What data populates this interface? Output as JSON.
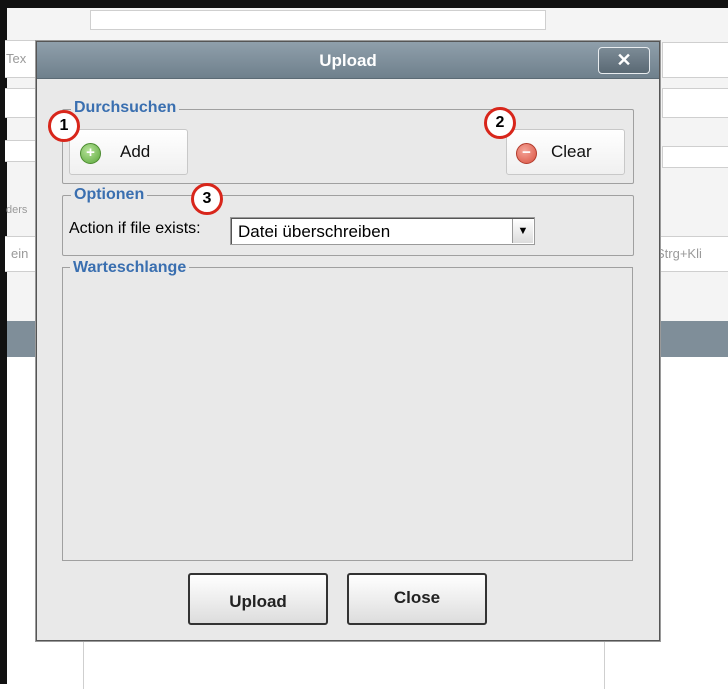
{
  "background": {
    "fragments": [
      "Tex",
      "ders",
      "ein",
      "Strg+Kli"
    ]
  },
  "dialog": {
    "title": "Upload",
    "close_glyph": "✕",
    "browse": {
      "legend": "Durchsuchen",
      "add_label": "Add",
      "add_icon": "plus-circle-icon",
      "clear_label": "Clear",
      "clear_icon": "minus-circle-icon"
    },
    "options": {
      "legend": "Optionen",
      "action_label": "Action if file exists:",
      "action_value": "Datei überschreiben"
    },
    "queue": {
      "legend": "Warteschlange"
    },
    "upload_label": "Upload",
    "close_label": "Close"
  },
  "markers": [
    "1",
    "2",
    "3"
  ],
  "colors": {
    "titlebar": "#7f8e99",
    "legend_text": "#3a6fb0",
    "marker_ring": "#d8261b",
    "add_icon": "#5aa73a",
    "clear_icon": "#d9503f"
  }
}
